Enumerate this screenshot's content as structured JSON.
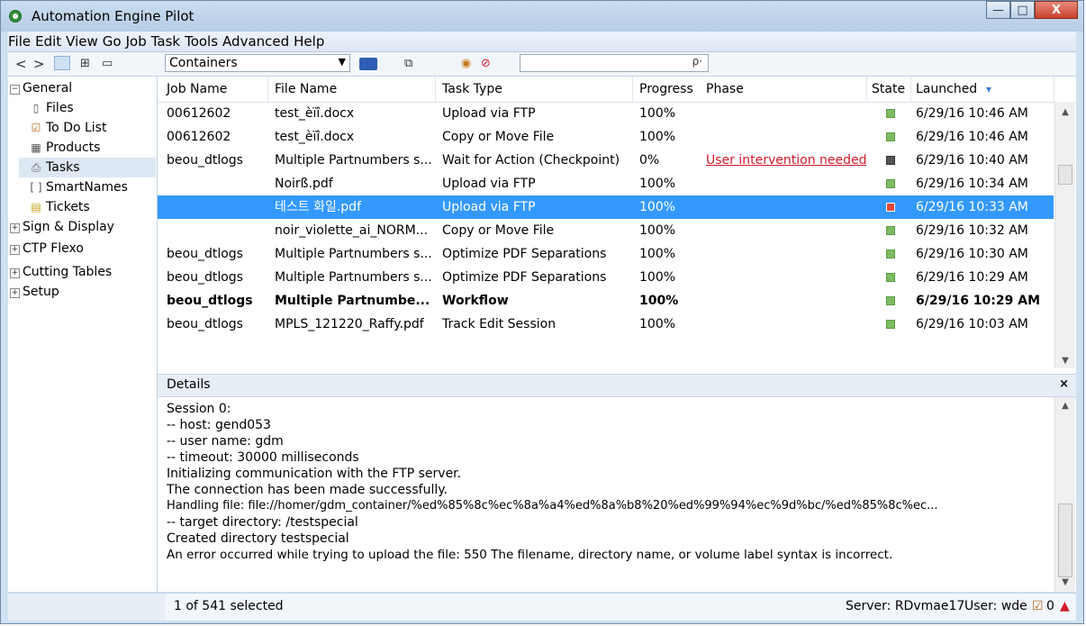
{
  "window": {
    "title": "Automation Engine Pilot",
    "minimize": "—",
    "maximize": "□",
    "close": "X"
  },
  "menu": [
    "File",
    "Edit",
    "View",
    "Go",
    "Job",
    "Task",
    "Tools",
    "Advanced",
    "Help"
  ],
  "toolbar": {
    "back": "<",
    "forward": ">",
    "view_container": "Containers",
    "search_value": "",
    "search_icon": "ρ·"
  },
  "sidebar": {
    "items": [
      {
        "label": "General",
        "type": "group"
      },
      {
        "label": "Files",
        "type": "child",
        "icon": "file-icon"
      },
      {
        "label": "To Do List",
        "type": "child",
        "icon": "todo-icon"
      },
      {
        "label": "Products",
        "type": "child",
        "icon": "products-icon"
      },
      {
        "label": "Tasks",
        "type": "child",
        "icon": "tasks-icon",
        "selected": true
      },
      {
        "label": "SmartNames",
        "type": "child",
        "icon": "smartnames-icon"
      },
      {
        "label": "Tickets",
        "type": "child",
        "icon": "tickets-icon"
      },
      {
        "label": "Sign & Display",
        "type": "group"
      },
      {
        "label": "CTP Flexo",
        "type": "group"
      },
      {
        "label": "Cutting Tables",
        "type": "group"
      },
      {
        "label": "Setup",
        "type": "group"
      }
    ]
  },
  "grid": {
    "columns": [
      "Job Name",
      "File Name",
      "Task Type",
      "Progress",
      "Phase",
      "State",
      "Launched"
    ],
    "sort_indicator": "▾",
    "rows": [
      {
        "job": "00612602",
        "file": "test_èïî.docx",
        "task": "Upload via FTP",
        "progress": "100%",
        "phase": "",
        "state": "ok",
        "launched": "6/29/16 10:46 AM"
      },
      {
        "job": "00612602",
        "file": "test_èïî.docx",
        "task": "Copy or Move File",
        "progress": "100%",
        "phase": "",
        "state": "ok",
        "launched": "6/29/16 10:46 AM"
      },
      {
        "job": "beou_dtlogs",
        "file": "Multiple Partnumbers s...",
        "task": "Wait for Action (Checkpoint)",
        "progress": "0%",
        "phase": "User intervention needed",
        "state": "wait",
        "launched": "6/29/16 10:40 AM"
      },
      {
        "job": "",
        "file": "Noirß.pdf",
        "task": "Upload via FTP",
        "progress": "100%",
        "phase": "",
        "state": "ok",
        "launched": "6/29/16 10:34 AM"
      },
      {
        "job": "",
        "file": "테스트 화일.pdf",
        "task": "Upload via FTP",
        "progress": "100%",
        "phase": "",
        "state": "err",
        "launched": "6/29/16 10:33 AM",
        "selected": true
      },
      {
        "job": "",
        "file": "noir_violette_ai_NORM...",
        "task": "Copy or Move File",
        "progress": "100%",
        "phase": "",
        "state": "ok",
        "launched": "6/29/16 10:32 AM"
      },
      {
        "job": "beou_dtlogs",
        "file": "Multiple Partnumbers s...",
        "task": "Optimize PDF Separations",
        "progress": "100%",
        "phase": "",
        "state": "ok",
        "launched": "6/29/16 10:30 AM"
      },
      {
        "job": "beou_dtlogs",
        "file": "Multiple Partnumbers s...",
        "task": "Optimize PDF Separations",
        "progress": "100%",
        "phase": "",
        "state": "ok",
        "launched": "6/29/16 10:29 AM"
      },
      {
        "job": "beou_dtlogs",
        "file": "Multiple Partnumbe...",
        "task": "Workflow",
        "progress": "100%",
        "phase": "",
        "state": "ok",
        "launched": "6/29/16 10:29 AM",
        "bold": true
      },
      {
        "job": "beou_dtlogs",
        "file": "MPLS_121220_Raffy.pdf",
        "task": "Track Edit Session",
        "progress": "100%",
        "phase": "",
        "state": "ok",
        "launched": "6/29/16 10:03 AM"
      }
    ]
  },
  "details": {
    "title": "Details",
    "close": "×",
    "lines": [
      "Session 0:",
      "-- host: gend053",
      "-- user name: gdm",
      "-- timeout: 30000 milliseconds",
      "Initializing communication with the FTP server.",
      "The connection has been made successfully.",
      "Handling file: file://homer/gdm_container/%ed%85%8c%ec%8a%a4%ed%8a%b8%20%ed%99%94%ec%9d%bc/%ed%85%8c%ec...",
      "-- target directory: /testspecial",
      "Created directory testspecial",
      "An error occurred while trying to upload the file: 550 The filename, directory name, or volume label syntax is incorrect."
    ]
  },
  "status": {
    "selection": "1 of 541 selected",
    "server": "Server: RDvmae17",
    "user": "User: wde",
    "todo_count": "0"
  },
  "colors": {
    "selection": "#3399ff",
    "phase_warning": "#d0192a",
    "state_ok": "#7dbd62",
    "state_error": "#e2473a"
  }
}
